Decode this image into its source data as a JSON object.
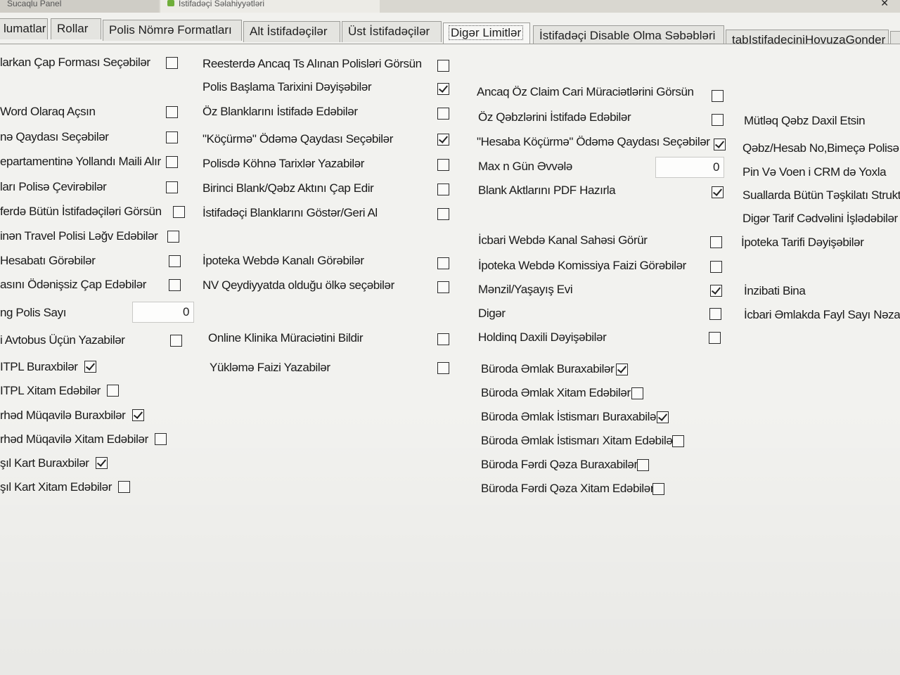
{
  "window": {
    "tab1_title": "Sucaqlu Panel",
    "tab2_title": "İstifadəçi Səlahiyyətləri",
    "close_glyph": "✕"
  },
  "tabs": [
    {
      "label": "lumatlar",
      "active": false
    },
    {
      "label": "Rollar",
      "active": false
    },
    {
      "label": "Polis Nömrə Formatları",
      "active": false
    },
    {
      "label": "Alt İstifadəçilər",
      "active": false
    },
    {
      "label": "Üst İstifadəçilər",
      "active": false
    },
    {
      "label": "Digər Limitlər",
      "active": true
    },
    {
      "label": "İstifadəçi Disable Olma Səbəbləri",
      "active": false
    },
    {
      "label": "tabIstifadeciniHovuzaGonder",
      "active": false
    }
  ],
  "col1": [
    {
      "label": "larkan Çap Forması Seçəbilər",
      "checked": false
    },
    {
      "label": "Word Olaraq Açsın",
      "checked": false
    },
    {
      "label": "nə Qaydası Seçəbilər",
      "checked": false
    },
    {
      "label": "epartamentinə Yollandı Maili Alır",
      "checked": false
    },
    {
      "label": "ları Polisə Çevirəbilər",
      "checked": false
    },
    {
      "label": "ferdə Bütün İstifadəçiləri Görsün",
      "checked": false
    },
    {
      "label": "inən Travel Polisi Ləğv Edəbilər",
      "checked": false
    },
    {
      "label": "Hesabatı Görəbilər",
      "checked": false
    },
    {
      "label": "asını Ödənişsiz Çap Edəbilər",
      "checked": false
    },
    {
      "label": "ng Polis Sayı",
      "value": "0"
    },
    {
      "label": "i Avtobus Üçün Yazabilər",
      "checked": false
    },
    {
      "label": "ITPL Buraxbilər",
      "checked": true
    },
    {
      "label": "ITPL Xitam Edəbilər",
      "checked": false
    },
    {
      "label": "rhəd Müqavilə Buraxbilər",
      "checked": true
    },
    {
      "label": "rhəd Müqavilə Xitam Edəbilər",
      "checked": false
    },
    {
      "label": "şıl Kart Buraxbilər",
      "checked": true
    },
    {
      "label": "şıl Kart Xitam Edəbilər",
      "checked": false
    }
  ],
  "col2": [
    {
      "label": "Reesterdə Ancaq Ts Alınan Polisləri Görsün",
      "checked": false
    },
    {
      "label": "Polis Başlama Tarixini Dəyişəbilər",
      "checked": true
    },
    {
      "label": "Öz Blanklarını İstifadə Edəbilər",
      "checked": false
    },
    {
      "label": "\"Köçürmə\" Ödəmə Qaydası Seçəbilər",
      "checked": true
    },
    {
      "label": "Polisdə Köhnə Tarixlər Yazabilər",
      "checked": false
    },
    {
      "label": "Birinci Blank/Qəbz Aktını Çap Edir",
      "checked": false
    },
    {
      "label": "İstifadəçi Blanklarını Göstər/Geri Al",
      "checked": false
    },
    {
      "label": "İpoteka Webdə Kanalı Görəbilər",
      "checked": false
    },
    {
      "label": "NV Qeydiyyatda olduğu ölkə seçəbilər",
      "checked": false
    },
    {
      "label": "Online Klinika Müraciətini Bildir",
      "checked": false
    },
    {
      "label": "Yükləmə Faizi Yazabilər",
      "checked": false
    }
  ],
  "col3": [
    {
      "label": "Ancaq Öz Claim Cari Müraciətlərini Görsün",
      "checked": false
    },
    {
      "label": "Öz Qəbzlərini İstifadə Edəbilər",
      "checked": false
    },
    {
      "label": "\"Hesaba Köçürmə\" Ödəmə Qaydası Seçəbilər",
      "checked": true
    },
    {
      "label": "Max n Gün Əvvələ",
      "value": "0"
    },
    {
      "label": "Blank Aktlarını PDF Hazırla",
      "checked": true
    },
    {
      "label": "İcbari Webdə Kanal Sahəsi Görür",
      "checked": false
    },
    {
      "label": "İpoteka Webdə Komissiya Faizi Görəbilər",
      "checked": false
    },
    {
      "label": "Mənzil/Yaşayış Evi",
      "checked": true
    },
    {
      "label": "Digər",
      "checked": false
    },
    {
      "label": "Holdinq Daxili Dəyişəbilər",
      "checked": false
    },
    {
      "label": "Büroda Əmlak Buraxabilər",
      "checked": true
    },
    {
      "label": "Büroda Əmlak Xitam Edəbilər",
      "checked": false
    },
    {
      "label": "Büroda Əmlak İstismarı Buraxabilər",
      "checked": true
    },
    {
      "label": "Büroda Əmlak İstismarı Xitam Edəbilər",
      "checked": false
    },
    {
      "label": "Büroda Fərdi Qəza Buraxabilər",
      "checked": false
    },
    {
      "label": "Büroda Fərdi Qəza Xitam Edəbilər",
      "checked": false
    }
  ],
  "col4": [
    {
      "label": "Mütləq Qəbz Daxil Etsin"
    },
    {
      "label": "Qəbz/Hesab No,Bimeçə Polisə V"
    },
    {
      "label": "Pin Və Voen i CRM də Yoxla"
    },
    {
      "label": "Suallarda Bütün Təşkilatı Struktur"
    },
    {
      "label": "Digər Tarif Cədvəlini İşlədəbilər"
    },
    {
      "label": "İpoteka Tarifi Dəyişəbilər"
    },
    {
      "label": "İnzibati Bina"
    },
    {
      "label": "İcbari Əmlakda Fayl Sayı Nəzarəti"
    }
  ]
}
